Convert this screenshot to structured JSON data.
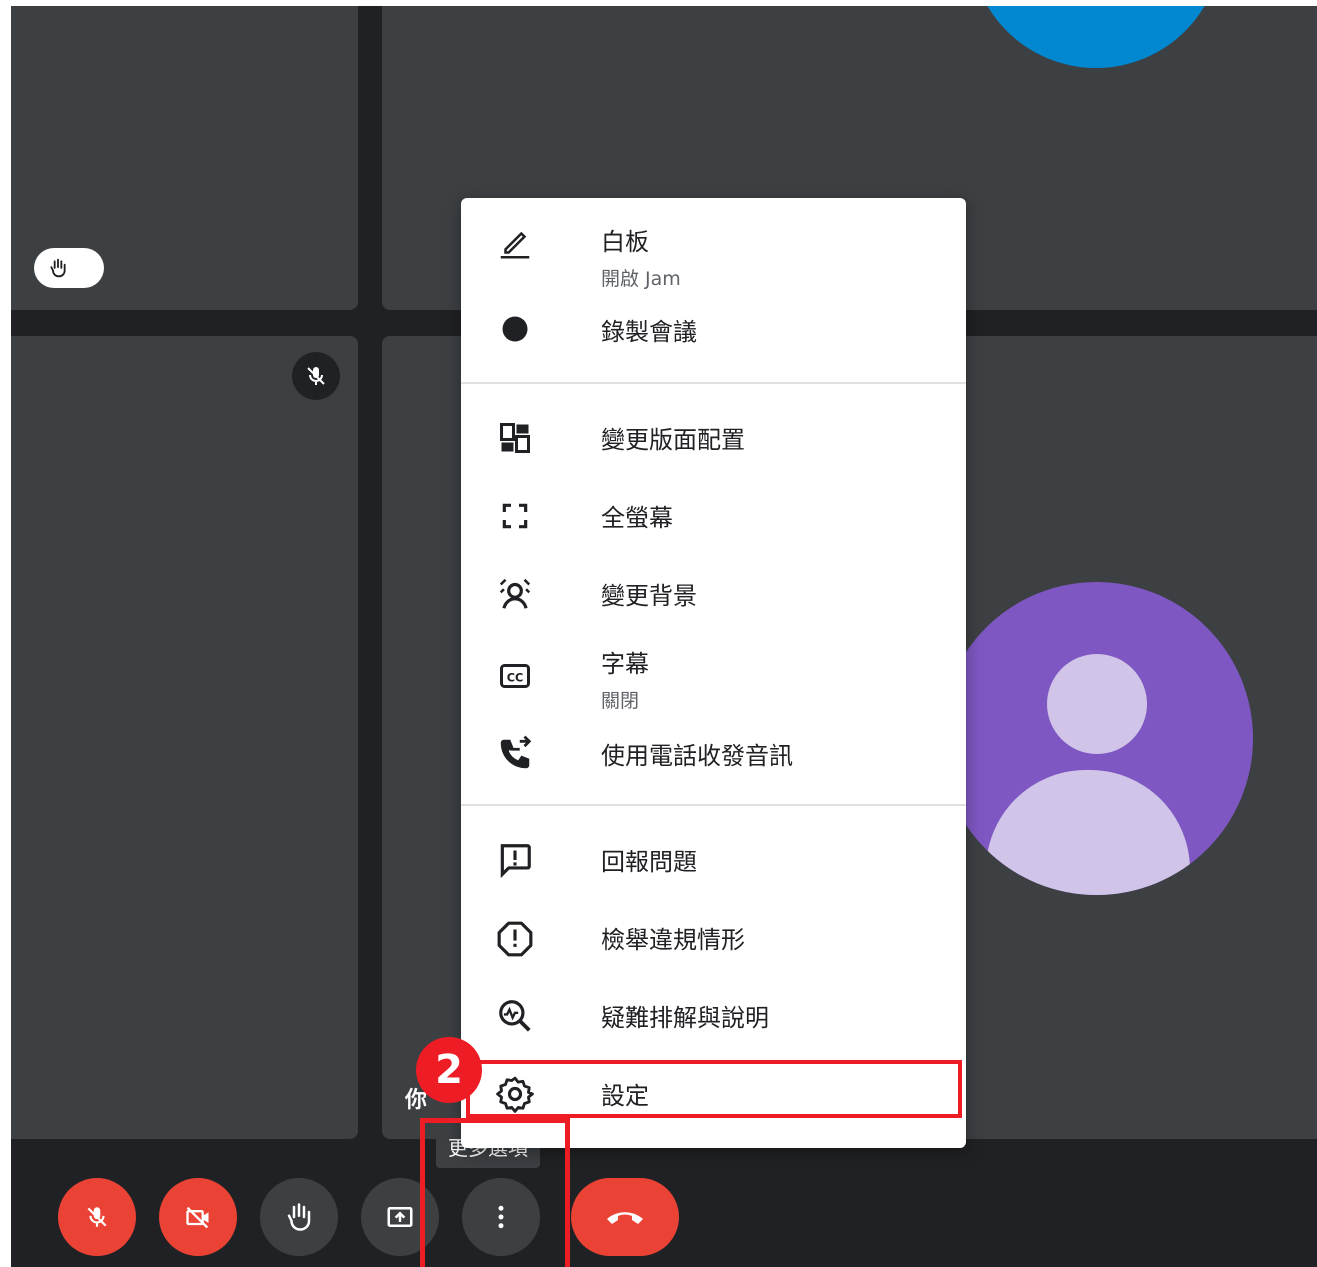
{
  "participants": {
    "self_label": "你"
  },
  "menu": {
    "items": [
      {
        "icon": "pen-icon",
        "label": "白板",
        "sub": "開啟 Jam"
      },
      {
        "icon": "record-dot-icon",
        "label": "錄製會議"
      },
      {
        "icon": "layout-icon",
        "label": "變更版面配置"
      },
      {
        "icon": "fullscreen-icon",
        "label": "全螢幕"
      },
      {
        "icon": "background-blur-icon",
        "label": "變更背景"
      },
      {
        "icon": "closed-caption-icon",
        "label": "字幕",
        "sub": "關閉"
      },
      {
        "icon": "phone-forward-icon",
        "label": "使用電話收發音訊"
      },
      {
        "icon": "feedback-icon",
        "label": "回報問題"
      },
      {
        "icon": "report-icon",
        "label": "檢舉違規情形"
      },
      {
        "icon": "troubleshoot-icon",
        "label": "疑難排解與說明"
      },
      {
        "icon": "gear-icon",
        "label": "設定"
      }
    ]
  },
  "tooltip": "更多選項",
  "annotation": {
    "step": "2"
  },
  "colors": {
    "meeting_bg": "#202124",
    "tile": "#3c4043",
    "danger": "#ea4335",
    "highlight": "#ee1c25",
    "avatar_blue": "#0288d1",
    "avatar_purple": "#7e57c2"
  }
}
